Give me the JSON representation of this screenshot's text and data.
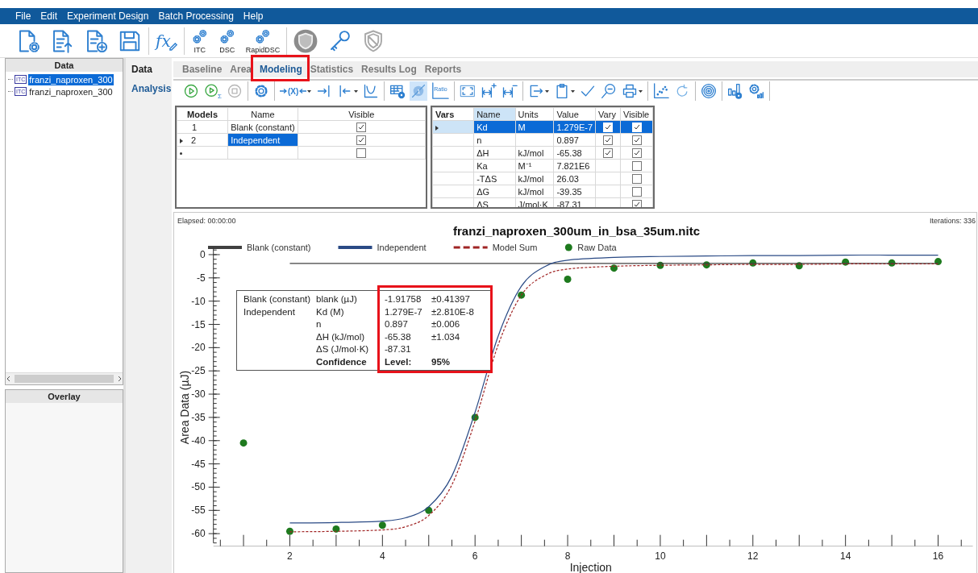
{
  "menu": [
    "File",
    "Edit",
    "Experiment Design",
    "Batch Processing",
    "Help"
  ],
  "toolbar_labels": [
    "fx",
    "ITC",
    "DSC",
    "RapidDSC"
  ],
  "data_panel": {
    "title": "Data",
    "items": [
      {
        "badge": "ITC",
        "label": "franzi_naproxen_300",
        "selected": true
      },
      {
        "badge": "ITC",
        "label": "franzi_naproxen_300",
        "selected": false
      }
    ]
  },
  "overlay_panel": {
    "title": "Overlay"
  },
  "nav": [
    {
      "label": "Data",
      "selected": false
    },
    {
      "label": "Analysis",
      "selected": true
    }
  ],
  "tabs": [
    {
      "label": "Baseline",
      "selected": false,
      "annotated": false
    },
    {
      "label": "Area",
      "selected": false,
      "annotated": false
    },
    {
      "label": "Modeling",
      "selected": true,
      "annotated": true
    },
    {
      "label": "Statistics",
      "selected": false,
      "annotated": false
    },
    {
      "label": "Results Log",
      "selected": false,
      "annotated": false
    },
    {
      "label": "Reports",
      "selected": false,
      "annotated": false
    }
  ],
  "analysis_toolbar": [
    [
      {
        "pressed": false,
        "dropdown": false
      },
      {
        "label": "Σ",
        "pressed": false,
        "dropdown": false
      },
      {
        "pressed": false,
        "dropdown": false
      }
    ],
    [
      {
        "pressed": false,
        "dropdown": false
      }
    ],
    [
      {
        "label": "(X)",
        "dropdown": true,
        "pressed": false
      },
      {
        "pressed": false,
        "dropdown": false
      },
      {
        "dropdown": true,
        "pressed": false
      },
      {
        "pressed": false,
        "dropdown": false
      }
    ],
    [
      {
        "pressed": false,
        "dropdown": false
      },
      {
        "label": "1",
        "pressed": true,
        "dropdown": false
      },
      {
        "label": "Ratio",
        "pressed": false,
        "dropdown": false
      }
    ],
    [
      {
        "pressed": false,
        "dropdown": false
      },
      {
        "pressed": false,
        "dropdown": false
      },
      {
        "pressed": false,
        "dropdown": false
      }
    ],
    [
      {
        "dropdown": true,
        "pressed": false
      },
      {
        "dropdown": true,
        "pressed": false
      },
      {
        "pressed": false,
        "dropdown": false
      },
      {
        "pressed": false,
        "dropdown": false
      },
      {
        "dropdown": true,
        "pressed": false
      }
    ],
    [
      {
        "pressed": false,
        "dropdown": false
      },
      {
        "pressed": false,
        "dropdown": false
      }
    ],
    [
      {
        "pressed": false,
        "dropdown": false
      }
    ],
    [
      {
        "pressed": false,
        "dropdown": false
      },
      {
        "pressed": false,
        "dropdown": false
      }
    ]
  ],
  "models_table": {
    "columns": [
      "Models",
      "Name",
      "Visible"
    ],
    "rows": [
      {
        "kind": "model",
        "number": "1",
        "name": "Blank (constant)",
        "visible": true,
        "current": false,
        "selected": false
      },
      {
        "kind": "model",
        "number": "2",
        "name": "Independent",
        "visible": true,
        "current": true,
        "selected": true
      },
      {
        "kind": "new",
        "visible": false,
        "current": false,
        "selected": false
      }
    ]
  },
  "vars_table": {
    "columns": [
      "Vars",
      "Name",
      "Units",
      "Value",
      "Vary",
      "Visible"
    ],
    "rows": [
      {
        "name": "Kd",
        "units": "M",
        "value": "1.279E-7",
        "vary": true,
        "visible": true,
        "selected": true
      },
      {
        "name": "n",
        "value": "0.897",
        "vary": true,
        "visible": true,
        "selected": false
      },
      {
        "name": "ΔH",
        "units": "kJ/mol",
        "value": "-65.38",
        "vary": true,
        "visible": true,
        "selected": false
      },
      {
        "name": "Ka",
        "units": "M⁻¹",
        "value": "7.821E6",
        "visible": false,
        "selected": false
      },
      {
        "name": "-TΔS",
        "units": "kJ/mol",
        "value": "26.03",
        "visible": false,
        "selected": false
      },
      {
        "name": "ΔG",
        "units": "kJ/mol",
        "value": "-39.35",
        "visible": false,
        "selected": false
      },
      {
        "name": "ΔS",
        "units": "J/mol·K",
        "value": "-87.31",
        "visible": true,
        "selected": false
      }
    ]
  },
  "chart": {
    "elapsed": "Elapsed: 00:00:00",
    "iterations": "Iterations: 336",
    "chart_data": {
      "type": "line",
      "title": "franzi_naproxen_300um_in_bsa_35um.nitc",
      "xlabel": "Injection",
      "ylabel": "Area Data (µJ)",
      "legend": "top",
      "x": [
        1,
        2,
        3,
        4,
        4.5,
        5,
        5.5,
        6,
        6.5,
        7,
        7.5,
        8,
        9,
        10,
        11,
        12,
        13,
        14,
        15,
        16
      ],
      "series": [
        {
          "name": "Blank (constant)",
          "color": "#404040",
          "values": [
            null,
            -1.9,
            -1.9,
            -1.9,
            -1.9,
            -1.9,
            -1.9,
            -1.9,
            -1.9,
            -1.9,
            -1.9,
            -1.9,
            -1.9,
            -1.9,
            -1.9,
            -1.9,
            -1.9,
            -1.9,
            -1.9,
            -1.9
          ]
        },
        {
          "name": "Independent",
          "color": "#2a4a85",
          "values": [
            null,
            -57.7,
            -57.6,
            -57.3,
            -56.6,
            -54.2,
            -47.6,
            -33.9,
            -17.5,
            -6.8,
            -2.6,
            -1.2,
            -0.6,
            -0.4,
            -0.3,
            -0.2,
            -0.2,
            -0.1,
            -0.1,
            -0.1
          ]
        },
        {
          "name": "Model Sum",
          "color": "#a02424",
          "line_style": "dashed",
          "values": [
            null,
            -59.6,
            -59.5,
            -59.2,
            -58.5,
            -56.1,
            -49.5,
            -35.8,
            -19.4,
            -8.7,
            -4.5,
            -3.1,
            -2.5,
            -2.3,
            -2.2,
            -2.1,
            -2.1,
            -2.0,
            -2.0,
            -2.0
          ]
        },
        {
          "name": "Raw Data",
          "color": "#1e7a1e",
          "type": "scatter",
          "values": [
            -40.5,
            -59.5,
            -59.0,
            -58.2,
            null,
            -55.0,
            null,
            -35.0,
            null,
            -8.7,
            null,
            -5.3,
            -2.9,
            -2.3,
            -2.2,
            -1.8,
            -2.4,
            -1.6,
            -1.8,
            -1.5
          ]
        }
      ],
      "xlim": [
        0.35,
        16.75
      ],
      "ylim": [
        -62,
        1.5
      ],
      "xticks": [
        2,
        4,
        6,
        8,
        10,
        12,
        14,
        16
      ],
      "yticks": [
        0,
        -5,
        -10,
        -15,
        -20,
        -25,
        -30,
        -35,
        -40,
        -45,
        -50,
        -55,
        -60
      ]
    },
    "fit_results": {
      "annotated": true,
      "rows": [
        {
          "model": "Blank (constant)",
          "parameter": "blank (µJ)",
          "value": "-1.91758",
          "error": "±0.41397"
        },
        {
          "model": "Independent",
          "parameter": "Kd (M)",
          "value": "1.279E-7",
          "error": "±2.810E-8"
        },
        {
          "parameter": "n",
          "value": "0.897",
          "error": "±0.006"
        },
        {
          "parameter": "ΔH (kJ/mol)",
          "value": "-65.38",
          "error": "±1.034"
        },
        {
          "parameter": "ΔS (J/mol·K)",
          "value": "-87.31"
        },
        {
          "kind": "confidence",
          "parameter": "Confidence",
          "value": "Level:",
          "error": "95%"
        }
      ]
    }
  }
}
